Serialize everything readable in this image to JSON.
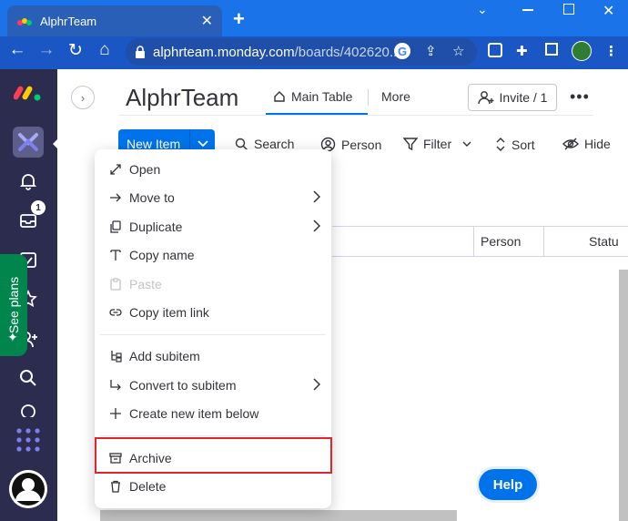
{
  "browser": {
    "tab_title": "AlphrTeam",
    "url_main": "alphrteam.monday.com",
    "url_rest": "/boards/402620...",
    "accent": "#1a73e8"
  },
  "rail": {
    "notification_count": "1",
    "see_plans": "See plans"
  },
  "board": {
    "title": "AlphrTeam",
    "tabs": [
      "Main Table",
      "More"
    ],
    "invite": "Invite / 1",
    "new_item": "New Item",
    "toolbar": [
      "Search",
      "Person",
      "Filter",
      "Sort",
      "Hide"
    ],
    "columns": [
      "Person",
      "Statu"
    ]
  },
  "menu": {
    "items": [
      {
        "label": "Open",
        "icon": "expand-icon"
      },
      {
        "label": "Move to",
        "icon": "arrow-right-icon"
      },
      {
        "label": "Duplicate",
        "icon": "duplicate-icon"
      },
      {
        "label": "Copy name",
        "icon": "text-icon"
      },
      {
        "label": "Paste",
        "icon": "clipboard-icon"
      },
      {
        "label": "Copy item link",
        "icon": "link-icon"
      },
      {
        "label": "Add subitem",
        "icon": "subitem-icon"
      },
      {
        "label": "Convert to subitem",
        "icon": "convert-icon"
      },
      {
        "label": "Create new item below",
        "icon": "plus-icon"
      },
      {
        "label": "Archive",
        "icon": "archive-icon"
      },
      {
        "label": "Delete",
        "icon": "trash-icon"
      }
    ]
  },
  "help": "Help"
}
